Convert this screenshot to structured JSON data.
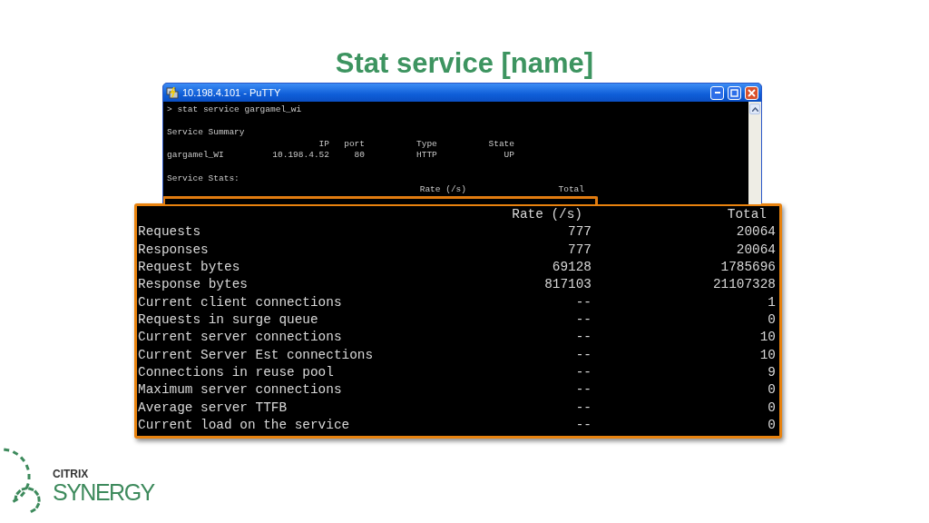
{
  "slide_title": "Stat service [name]",
  "window": {
    "title": "10.198.4.101 - PuTTY",
    "command": "> stat service gargamel_wi",
    "summary_heading": "Service Summary",
    "summary_columns": [
      "IP",
      "port",
      "Type",
      "State"
    ],
    "summary_row": [
      "gargamel_WI",
      "10.198.4.52",
      "80",
      "HTTP",
      "UP"
    ],
    "stats_heading": "Service Stats:",
    "stats_columns": [
      "Rate (/s)",
      "Total"
    ]
  },
  "zoom": {
    "columns": [
      "Rate (/s)",
      "Total"
    ],
    "rows": [
      {
        "label": "Requests",
        "rate": "777",
        "total": "20064"
      },
      {
        "label": "Responses",
        "rate": "777",
        "total": "20064"
      },
      {
        "label": "Request bytes",
        "rate": "69128",
        "total": "1785696"
      },
      {
        "label": "Response bytes",
        "rate": "817103",
        "total": "21107328"
      },
      {
        "label": "Current client connections",
        "rate": "--",
        "total": "1"
      },
      {
        "label": "Requests in surge queue",
        "rate": "--",
        "total": "0"
      },
      {
        "label": "Current server connections",
        "rate": "--",
        "total": "10"
      },
      {
        "label": "Current Server Est connections",
        "rate": "--",
        "total": "10"
      },
      {
        "label": "Connections in reuse pool",
        "rate": "--",
        "total": "9"
      },
      {
        "label": "Maximum server connections",
        "rate": "--",
        "total": "0"
      },
      {
        "label": "Average server TTFB",
        "rate": "--",
        "total": "0"
      },
      {
        "label": "Current load on the service",
        "rate": "--",
        "total": "0"
      }
    ]
  },
  "logo": {
    "brand": "CITRIX",
    "product": "SYNERGY"
  }
}
